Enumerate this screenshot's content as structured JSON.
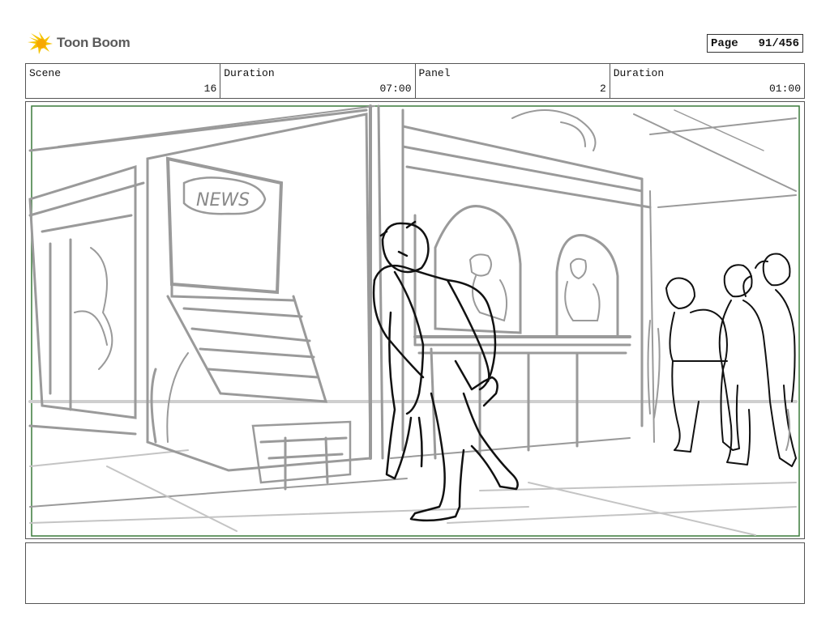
{
  "header": {
    "logo_text": "Toon Boom",
    "page_label": "Page",
    "page_value": "91/456"
  },
  "info": {
    "scene_label": "Scene",
    "scene_value": "16",
    "duration1_label": "Duration",
    "duration1_value": "07:00",
    "panel_label": "Panel",
    "panel_value": "2",
    "duration2_label": "Duration",
    "duration2_value": "01:00"
  },
  "sketch": {
    "sign_text": "NEWS"
  },
  "colors": {
    "frame_green": "#3a7a3a",
    "sketch_grey": "#9a9a9a",
    "ink_black": "#111111",
    "logo_yellow": "#f5c400"
  }
}
